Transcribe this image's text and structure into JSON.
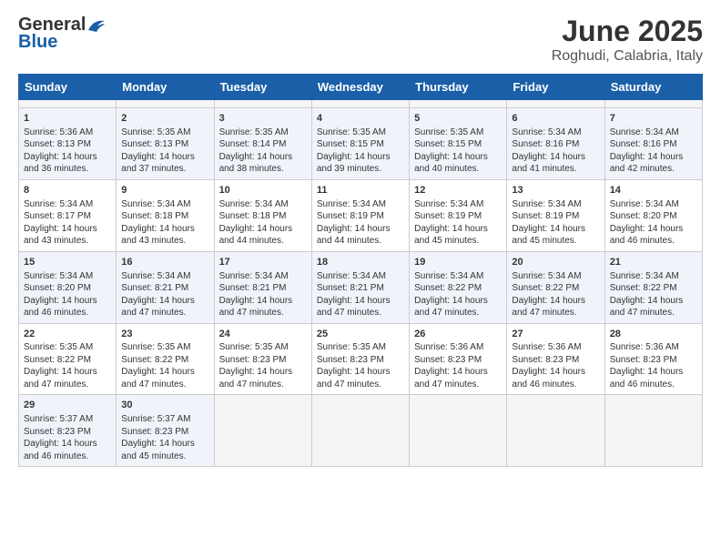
{
  "header": {
    "logo_general": "General",
    "logo_blue": "Blue",
    "title": "June 2025",
    "subtitle": "Roghudi, Calabria, Italy"
  },
  "calendar": {
    "days_of_week": [
      "Sunday",
      "Monday",
      "Tuesday",
      "Wednesday",
      "Thursday",
      "Friday",
      "Saturday"
    ],
    "weeks": [
      [
        {
          "day": "",
          "empty": true
        },
        {
          "day": "",
          "empty": true
        },
        {
          "day": "",
          "empty": true
        },
        {
          "day": "",
          "empty": true
        },
        {
          "day": "",
          "empty": true
        },
        {
          "day": "",
          "empty": true
        },
        {
          "day": "",
          "empty": true
        }
      ],
      [
        {
          "day": "1",
          "sunrise": "5:36 AM",
          "sunset": "8:13 PM",
          "daylight": "14 hours and 36 minutes."
        },
        {
          "day": "2",
          "sunrise": "5:35 AM",
          "sunset": "8:13 PM",
          "daylight": "14 hours and 37 minutes."
        },
        {
          "day": "3",
          "sunrise": "5:35 AM",
          "sunset": "8:14 PM",
          "daylight": "14 hours and 38 minutes."
        },
        {
          "day": "4",
          "sunrise": "5:35 AM",
          "sunset": "8:15 PM",
          "daylight": "14 hours and 39 minutes."
        },
        {
          "day": "5",
          "sunrise": "5:35 AM",
          "sunset": "8:15 PM",
          "daylight": "14 hours and 40 minutes."
        },
        {
          "day": "6",
          "sunrise": "5:34 AM",
          "sunset": "8:16 PM",
          "daylight": "14 hours and 41 minutes."
        },
        {
          "day": "7",
          "sunrise": "5:34 AM",
          "sunset": "8:16 PM",
          "daylight": "14 hours and 42 minutes."
        }
      ],
      [
        {
          "day": "8",
          "sunrise": "5:34 AM",
          "sunset": "8:17 PM",
          "daylight": "14 hours and 43 minutes."
        },
        {
          "day": "9",
          "sunrise": "5:34 AM",
          "sunset": "8:18 PM",
          "daylight": "14 hours and 43 minutes."
        },
        {
          "day": "10",
          "sunrise": "5:34 AM",
          "sunset": "8:18 PM",
          "daylight": "14 hours and 44 minutes."
        },
        {
          "day": "11",
          "sunrise": "5:34 AM",
          "sunset": "8:19 PM",
          "daylight": "14 hours and 44 minutes."
        },
        {
          "day": "12",
          "sunrise": "5:34 AM",
          "sunset": "8:19 PM",
          "daylight": "14 hours and 45 minutes."
        },
        {
          "day": "13",
          "sunrise": "5:34 AM",
          "sunset": "8:19 PM",
          "daylight": "14 hours and 45 minutes."
        },
        {
          "day": "14",
          "sunrise": "5:34 AM",
          "sunset": "8:20 PM",
          "daylight": "14 hours and 46 minutes."
        }
      ],
      [
        {
          "day": "15",
          "sunrise": "5:34 AM",
          "sunset": "8:20 PM",
          "daylight": "14 hours and 46 minutes."
        },
        {
          "day": "16",
          "sunrise": "5:34 AM",
          "sunset": "8:21 PM",
          "daylight": "14 hours and 47 minutes."
        },
        {
          "day": "17",
          "sunrise": "5:34 AM",
          "sunset": "8:21 PM",
          "daylight": "14 hours and 47 minutes."
        },
        {
          "day": "18",
          "sunrise": "5:34 AM",
          "sunset": "8:21 PM",
          "daylight": "14 hours and 47 minutes."
        },
        {
          "day": "19",
          "sunrise": "5:34 AM",
          "sunset": "8:22 PM",
          "daylight": "14 hours and 47 minutes."
        },
        {
          "day": "20",
          "sunrise": "5:34 AM",
          "sunset": "8:22 PM",
          "daylight": "14 hours and 47 minutes."
        },
        {
          "day": "21",
          "sunrise": "5:34 AM",
          "sunset": "8:22 PM",
          "daylight": "14 hours and 47 minutes."
        }
      ],
      [
        {
          "day": "22",
          "sunrise": "5:35 AM",
          "sunset": "8:22 PM",
          "daylight": "14 hours and 47 minutes."
        },
        {
          "day": "23",
          "sunrise": "5:35 AM",
          "sunset": "8:22 PM",
          "daylight": "14 hours and 47 minutes."
        },
        {
          "day": "24",
          "sunrise": "5:35 AM",
          "sunset": "8:23 PM",
          "daylight": "14 hours and 47 minutes."
        },
        {
          "day": "25",
          "sunrise": "5:35 AM",
          "sunset": "8:23 PM",
          "daylight": "14 hours and 47 minutes."
        },
        {
          "day": "26",
          "sunrise": "5:36 AM",
          "sunset": "8:23 PM",
          "daylight": "14 hours and 47 minutes."
        },
        {
          "day": "27",
          "sunrise": "5:36 AM",
          "sunset": "8:23 PM",
          "daylight": "14 hours and 46 minutes."
        },
        {
          "day": "28",
          "sunrise": "5:36 AM",
          "sunset": "8:23 PM",
          "daylight": "14 hours and 46 minutes."
        }
      ],
      [
        {
          "day": "29",
          "sunrise": "5:37 AM",
          "sunset": "8:23 PM",
          "daylight": "14 hours and 46 minutes."
        },
        {
          "day": "30",
          "sunrise": "5:37 AM",
          "sunset": "8:23 PM",
          "daylight": "14 hours and 45 minutes."
        },
        {
          "day": "",
          "empty": true
        },
        {
          "day": "",
          "empty": true
        },
        {
          "day": "",
          "empty": true
        },
        {
          "day": "",
          "empty": true
        },
        {
          "day": "",
          "empty": true
        }
      ]
    ]
  }
}
